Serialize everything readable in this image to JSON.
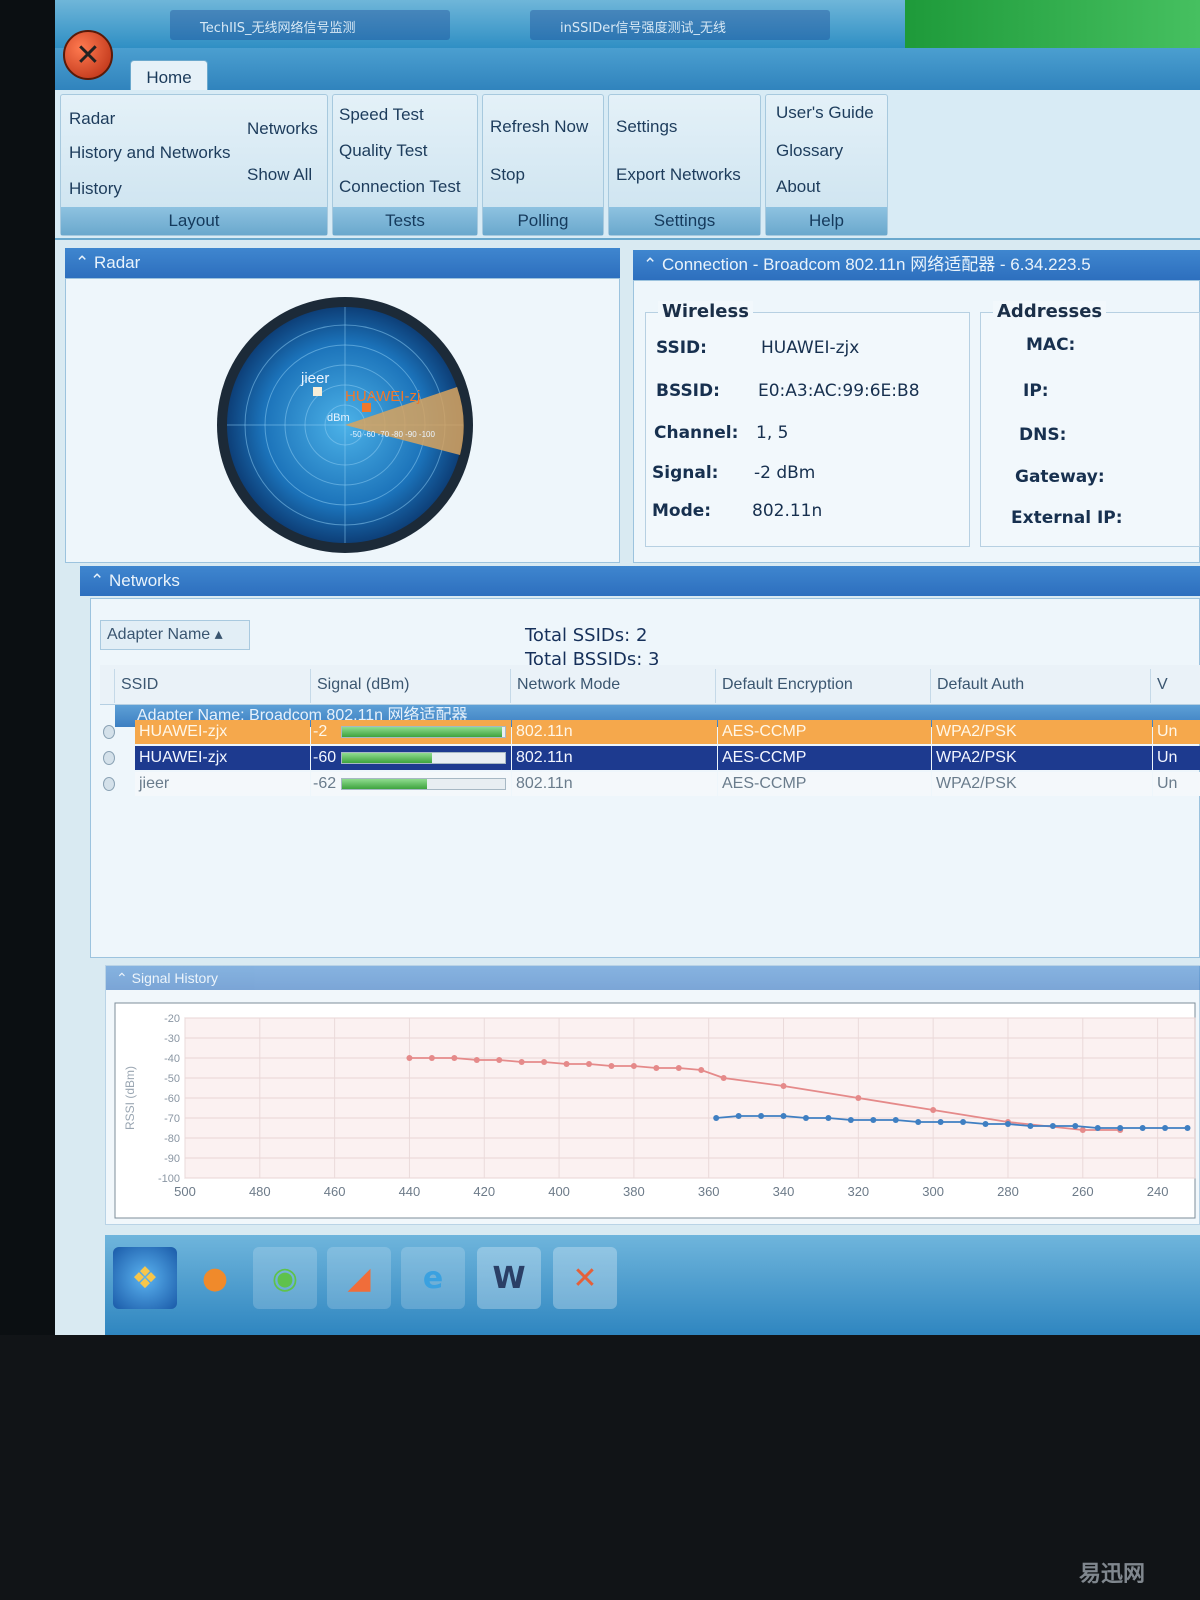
{
  "taskbar_top": {
    "tabs": [
      "TechIIS_无线网络信号监测",
      "inSSIDer信号强度测试_无线"
    ]
  },
  "ribbon": {
    "home_tab": "Home",
    "layout": {
      "label": "Layout",
      "radar": "Radar",
      "history_and_networks": "History and Networks",
      "history": "History",
      "networks": "Networks",
      "show_all": "Show All"
    },
    "tests": {
      "label": "Tests",
      "speed": "Speed Test",
      "quality": "Quality Test",
      "connection": "Connection Test"
    },
    "polling": {
      "label": "Polling",
      "refresh": "Refresh Now",
      "stop": "Stop"
    },
    "settings": {
      "label": "Settings",
      "settings": "Settings",
      "export": "Export Networks"
    },
    "help": {
      "label": "Help",
      "guide": "User's Guide",
      "glossary": "Glossary",
      "about": "About"
    }
  },
  "radar": {
    "title": "Radar",
    "labels": {
      "network_a": "jieer",
      "network_b": "HUAWEI-zj",
      "unit": "dBm",
      "scale": "-50 -60 -70 -80 -90 -100"
    }
  },
  "connection": {
    "title": "Connection - Broadcom 802.11n 网络适配器 - 6.34.223.5",
    "wireless": {
      "title": "Wireless",
      "ssid_label": "SSID:",
      "ssid": "HUAWEI-zjx",
      "bssid_label": "BSSID:",
      "bssid": "E0:A3:AC:99:6E:B8",
      "channel_label": "Channel:",
      "channel": "1, 5",
      "signal_label": "Signal:",
      "signal": "-2 dBm",
      "mode_label": "Mode:",
      "mode": "802.11n"
    },
    "addresses": {
      "title": "Addresses",
      "mac_label": "MAC:",
      "ip_label": "IP:",
      "dns_label": "DNS:",
      "gateway_label": "Gateway:",
      "external_ip_label": "External IP:"
    }
  },
  "networks": {
    "title": "Networks",
    "group_by": "Adapter Name ▴",
    "total_ssids": "Total SSIDs: 2",
    "total_bssids": "Total BSSIDs: 3",
    "columns": [
      "SSID",
      "Signal (dBm)",
      "Network Mode",
      "Default Encryption",
      "Default Auth",
      "V"
    ],
    "group_row": "Adapter Name: Broadcom 802.11n 网络适配器",
    "rows": [
      {
        "ssid": "HUAWEI-zjx",
        "signal": "-2",
        "signal_pct": 0.98,
        "mode": "802.11n",
        "enc": "AES-CCMP",
        "auth": "WPA2/PSK",
        "v": "Un",
        "style": "sel-orange"
      },
      {
        "ssid": "HUAWEI-zjx",
        "signal": "-60",
        "signal_pct": 0.55,
        "mode": "802.11n",
        "enc": "AES-CCMP",
        "auth": "WPA2/PSK",
        "v": "Un",
        "style": "sel-blue"
      },
      {
        "ssid": "jieer",
        "signal": "-62",
        "signal_pct": 0.52,
        "mode": "802.11n",
        "enc": "AES-CCMP",
        "auth": "WPA2/PSK",
        "v": "Un",
        "style": "plain"
      }
    ]
  },
  "history": {
    "title": "Signal History",
    "ylabel": "RSSI (dBm)"
  },
  "chart_data": {
    "type": "line",
    "title": "Signal History",
    "xlabel": "",
    "ylabel": "RSSI (dBm)",
    "xlim": [
      500,
      230
    ],
    "ylim": [
      -100,
      -20
    ],
    "y_ticks": [
      -20,
      -30,
      -40,
      -50,
      -60,
      -70,
      -80,
      -90,
      -100
    ],
    "x_ticks": [
      500,
      480,
      460,
      440,
      420,
      400,
      380,
      360,
      340,
      320,
      300,
      280,
      260,
      240
    ],
    "grid": true,
    "series": [
      {
        "color": "#e58a8a",
        "x": [
          440,
          434,
          428,
          422,
          416,
          410,
          404,
          398,
          392,
          386,
          380,
          374,
          368,
          362,
          356,
          340,
          320,
          300,
          280,
          260,
          250
        ],
        "y": [
          -40,
          -40,
          -40,
          -41,
          -41,
          -42,
          -42,
          -43,
          -43,
          -44,
          -44,
          -45,
          -45,
          -46,
          -50,
          -54,
          -60,
          -66,
          -72,
          -76,
          -76
        ]
      },
      {
        "color": "#3f7fc2",
        "x": [
          358,
          352,
          346,
          340,
          334,
          328,
          322,
          316,
          310,
          304,
          298,
          292,
          286,
          280,
          274,
          268,
          262,
          256,
          250,
          244,
          238,
          232
        ],
        "y": [
          -70,
          -69,
          -69,
          -69,
          -70,
          -70,
          -71,
          -71,
          -71,
          -72,
          -72,
          -72,
          -73,
          -73,
          -74,
          -74,
          -74,
          -75,
          -75,
          -75,
          -75,
          -75
        ]
      }
    ]
  },
  "taskbar": {
    "icons": [
      "start-orb-icon",
      "media-icon",
      "browser-icon",
      "chat-icon",
      "ie-icon",
      "word-icon",
      "inssider-icon"
    ]
  },
  "watermark": "易迅网"
}
